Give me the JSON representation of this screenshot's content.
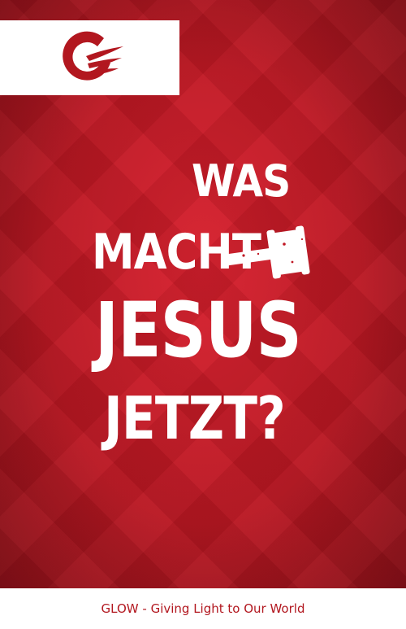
{
  "cover": {
    "background_color": "#c01824",
    "logo": {
      "name": "glow-logo",
      "color": "#b2171f"
    },
    "title_lines": [
      "WAS",
      "MACHT",
      "JESUS",
      "JETZT?"
    ],
    "gavel_icon": "gavel-icon"
  },
  "footer": {
    "text": "GLOW - Giving Light to Our World",
    "color": "#b2171f"
  }
}
